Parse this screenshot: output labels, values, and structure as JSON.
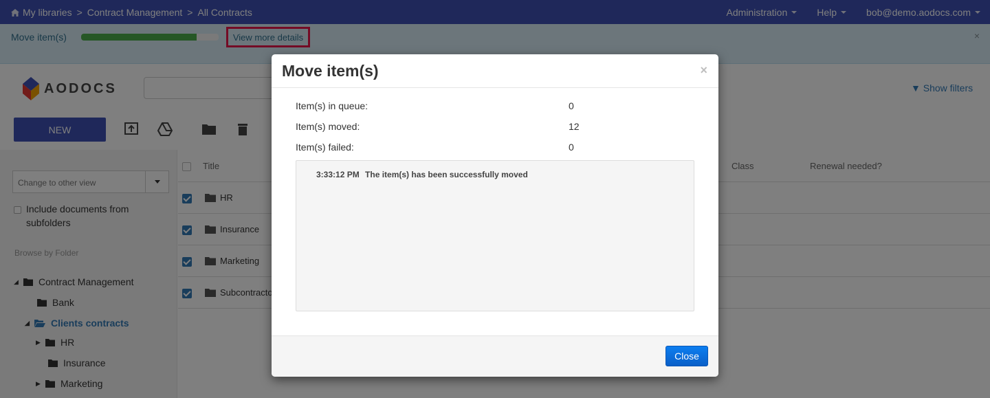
{
  "topnav": {
    "breadcrumbs": [
      "My libraries",
      "Contract Management",
      "All Contracts"
    ],
    "separator": ">",
    "menu": {
      "administration": "Administration",
      "help": "Help",
      "user": "bob@demo.aodocs.com"
    }
  },
  "banner": {
    "label": "Move item(s)",
    "progress": 0.84,
    "details_link": "View more details",
    "close": "×"
  },
  "header": {
    "logo_text": "AODOCS",
    "search_placeholder": "",
    "show_filters": "▼ Show filters"
  },
  "toolbar": {
    "new_label": "NEW",
    "icons": [
      "upload-icon",
      "google-drive-icon",
      "folder-icon",
      "trash-icon"
    ]
  },
  "sidebar": {
    "view_select": "Change to other view",
    "include_subfolders": "Include documents from subfolders",
    "browse_label": "Browse by Folder",
    "tree": [
      {
        "label": "Contract Management",
        "level": 0,
        "expanded": true
      },
      {
        "label": "Bank",
        "level": 1
      },
      {
        "label": "Clients contracts",
        "level": 1,
        "expanded": true,
        "active": true
      },
      {
        "label": "HR",
        "level": 2,
        "collapsed": true
      },
      {
        "label": "Insurance",
        "level": 2
      },
      {
        "label": "Marketing",
        "level": 2,
        "collapsed": true
      }
    ]
  },
  "table": {
    "columns": {
      "title": "Title",
      "class": "Class",
      "renewal": "Renewal needed?"
    },
    "rows": [
      {
        "name": "HR"
      },
      {
        "name": "Insurance"
      },
      {
        "name": "Marketing"
      },
      {
        "name": "Subcontracto"
      }
    ]
  },
  "modal": {
    "title": "Move item(s)",
    "close": "×",
    "stats": [
      {
        "label": "Item(s) in queue:",
        "value": "0"
      },
      {
        "label": "Item(s) moved:",
        "value": "12"
      },
      {
        "label": "Item(s) failed:",
        "value": "0"
      }
    ],
    "log": {
      "time": "3:33:12 PM",
      "message": "The item(s) has been successfully moved"
    },
    "close_button": "Close"
  },
  "colors": {
    "nav": "#3f51b5",
    "banner": "#d9edf7",
    "progress": "#4cae4c",
    "highlight": "#e8174a",
    "primary": "#337ab7"
  }
}
